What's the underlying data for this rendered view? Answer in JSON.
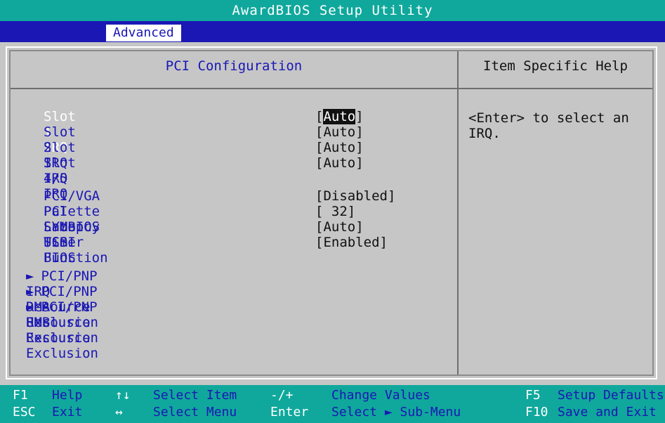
{
  "title": "AwardBIOS Setup Utility",
  "menu": {
    "active_tab": "Advanced"
  },
  "left_panel": {
    "title": "PCI Configuration",
    "items": [
      {
        "label": "Slot 1 IRQ",
        "value": "Auto",
        "selected": true
      },
      {
        "label": "Slot 2 IRQ",
        "value": "Auto"
      },
      {
        "label": "Slot 3 IRQ",
        "value": "Auto"
      },
      {
        "label": "Slot 4/5 IRQ",
        "value": "Auto"
      },
      {
        "label": "PCI/VGA Palette Snoop",
        "value": "Disabled"
      },
      {
        "label": "PCI Latency Timer",
        "value": " 32"
      },
      {
        "label": "SYMBIOS SCSI BIOS",
        "value": "Auto"
      },
      {
        "label": "USB Function",
        "value": "Enabled"
      }
    ],
    "submenus": [
      "PCI/PNP IRQ Resource Exclusion",
      "PCI/PNP DMA Resource Exclusion",
      "PCI/PNP UMB Resource Exclusion"
    ]
  },
  "right_panel": {
    "title": "Item Specific Help",
    "help_text": "<Enter> to select an IRQ."
  },
  "footer": {
    "row1": [
      {
        "key": "F1",
        "desc": "Help"
      },
      {
        "key": "↑↓",
        "desc": "Select Item"
      },
      {
        "key": "-/+",
        "desc": "Change Values"
      },
      {
        "key": "F5",
        "desc": "Setup Defaults"
      }
    ],
    "row2": [
      {
        "key": "ESC",
        "desc": "Exit"
      },
      {
        "key": "↔",
        "desc": "Select Menu"
      },
      {
        "key": "Enter",
        "desc": "Select ► Sub-Menu"
      },
      {
        "key": "F10",
        "desc": "Save and Exit"
      }
    ]
  },
  "colors": {
    "title_bar": "#10a89c",
    "menu_bar": "#1a17b4",
    "panel_bg": "#c6c6c6",
    "label_text": "#1a17b4"
  }
}
